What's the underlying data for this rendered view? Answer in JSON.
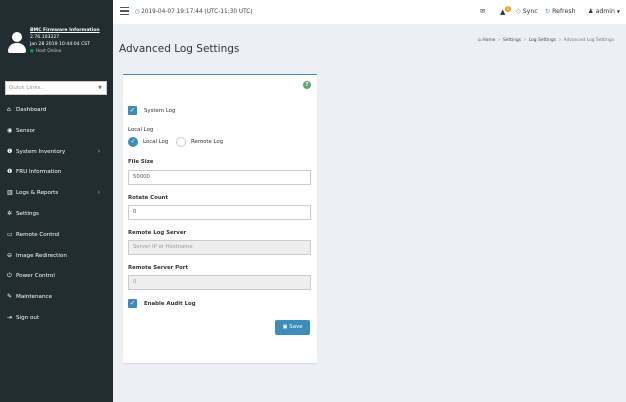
{
  "user": {
    "title": "BMC Firmware Information",
    "version": "2.76.103227",
    "date": "Jan 28 2019 10:44:04 CST",
    "status": "Host Online"
  },
  "quick_links": {
    "placeholder": "Quick Links.."
  },
  "menu": [
    {
      "label": "Dashboard",
      "icon": "dashboard-icon",
      "expandable": false
    },
    {
      "label": "Sensor",
      "icon": "sensor-icon",
      "expandable": false
    },
    {
      "label": "System Inventory",
      "icon": "info-icon",
      "expandable": true
    },
    {
      "label": "FRU Information",
      "icon": "info-icon",
      "expandable": false
    },
    {
      "label": "Logs & Reports",
      "icon": "chart-icon",
      "expandable": true
    },
    {
      "label": "Settings",
      "icon": "gear-icon",
      "expandable": false
    },
    {
      "label": "Remote Control",
      "icon": "monitor-icon",
      "expandable": false
    },
    {
      "label": "Image Redirection",
      "icon": "disk-icon",
      "expandable": false
    },
    {
      "label": "Power Control",
      "icon": "power-icon",
      "expandable": false
    },
    {
      "label": "Maintenance",
      "icon": "wrench-icon",
      "expandable": false
    },
    {
      "label": "Sign out",
      "icon": "sign-out-icon",
      "expandable": false
    }
  ],
  "topbar": {
    "datetime": "2019-04-07 19:17:44 (UTC-11:30 UTC)",
    "notif_count": "1",
    "sync_label": "Sync",
    "refresh_label": "Refresh",
    "user_label": "admin"
  },
  "page": {
    "title": "Advanced Log Settings",
    "breadcrumb": [
      "Home",
      "Settings",
      "Log Settings",
      "Advanced Log Settings"
    ]
  },
  "form": {
    "system_log_label": "System Log",
    "system_log_checked": true,
    "local_log_heading": "Local Log",
    "radio_local_label": "Local Log",
    "radio_remote_label": "Remote Log",
    "selected_log_type": "Local Log",
    "file_size_label": "File Size",
    "file_size_value": "50000",
    "rotate_count_label": "Rotate Count",
    "rotate_count_value": "0",
    "remote_server_label": "Remote Log Server",
    "remote_server_placeholder": "Server IP or Hostname",
    "remote_port_label": "Remote Server Port",
    "remote_port_value": "0",
    "audit_log_label": "Enable Audit Log",
    "audit_log_checked": true,
    "save_label": "Save"
  },
  "colors": {
    "accent": "#3c8dbc",
    "sidebar": "#222d32",
    "online": "#00a65a",
    "badge": "#f39c12",
    "help": "#65a46b"
  }
}
